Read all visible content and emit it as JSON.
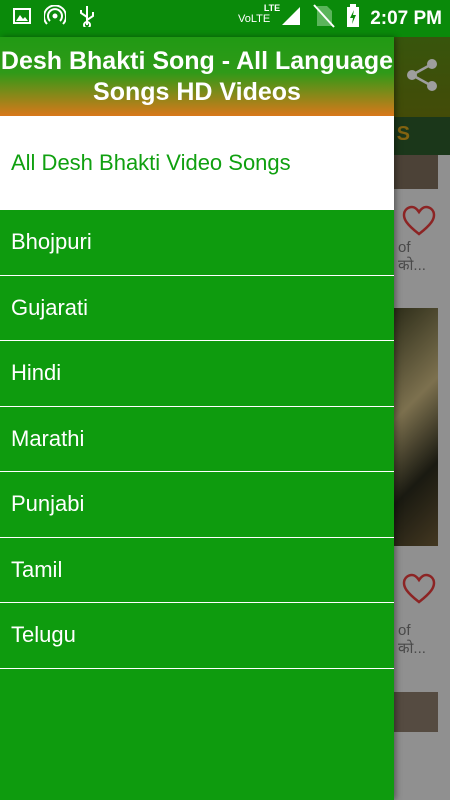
{
  "status_bar": {
    "time": "2:07 PM",
    "network": "VoLTE",
    "lte": "LTE"
  },
  "background": {
    "tab_text": "S",
    "card1_text_line1": "of",
    "card1_text_line2": "को...",
    "card2_text_line1": "of",
    "card2_text_line2": "को..."
  },
  "drawer": {
    "title": "Desh Bhakti Song - All Language Songs HD Videos",
    "items": [
      {
        "label": "All Desh Bhakti Video Songs",
        "active": true
      },
      {
        "label": "Bhojpuri"
      },
      {
        "label": "Gujarati"
      },
      {
        "label": "Hindi"
      },
      {
        "label": "Marathi"
      },
      {
        "label": "Punjabi"
      },
      {
        "label": "Tamil"
      },
      {
        "label": "Telugu"
      }
    ]
  },
  "colors": {
    "drawer_green": "#0e9b0e",
    "header_orange": "#d9781a",
    "active_text": "#10a010"
  }
}
